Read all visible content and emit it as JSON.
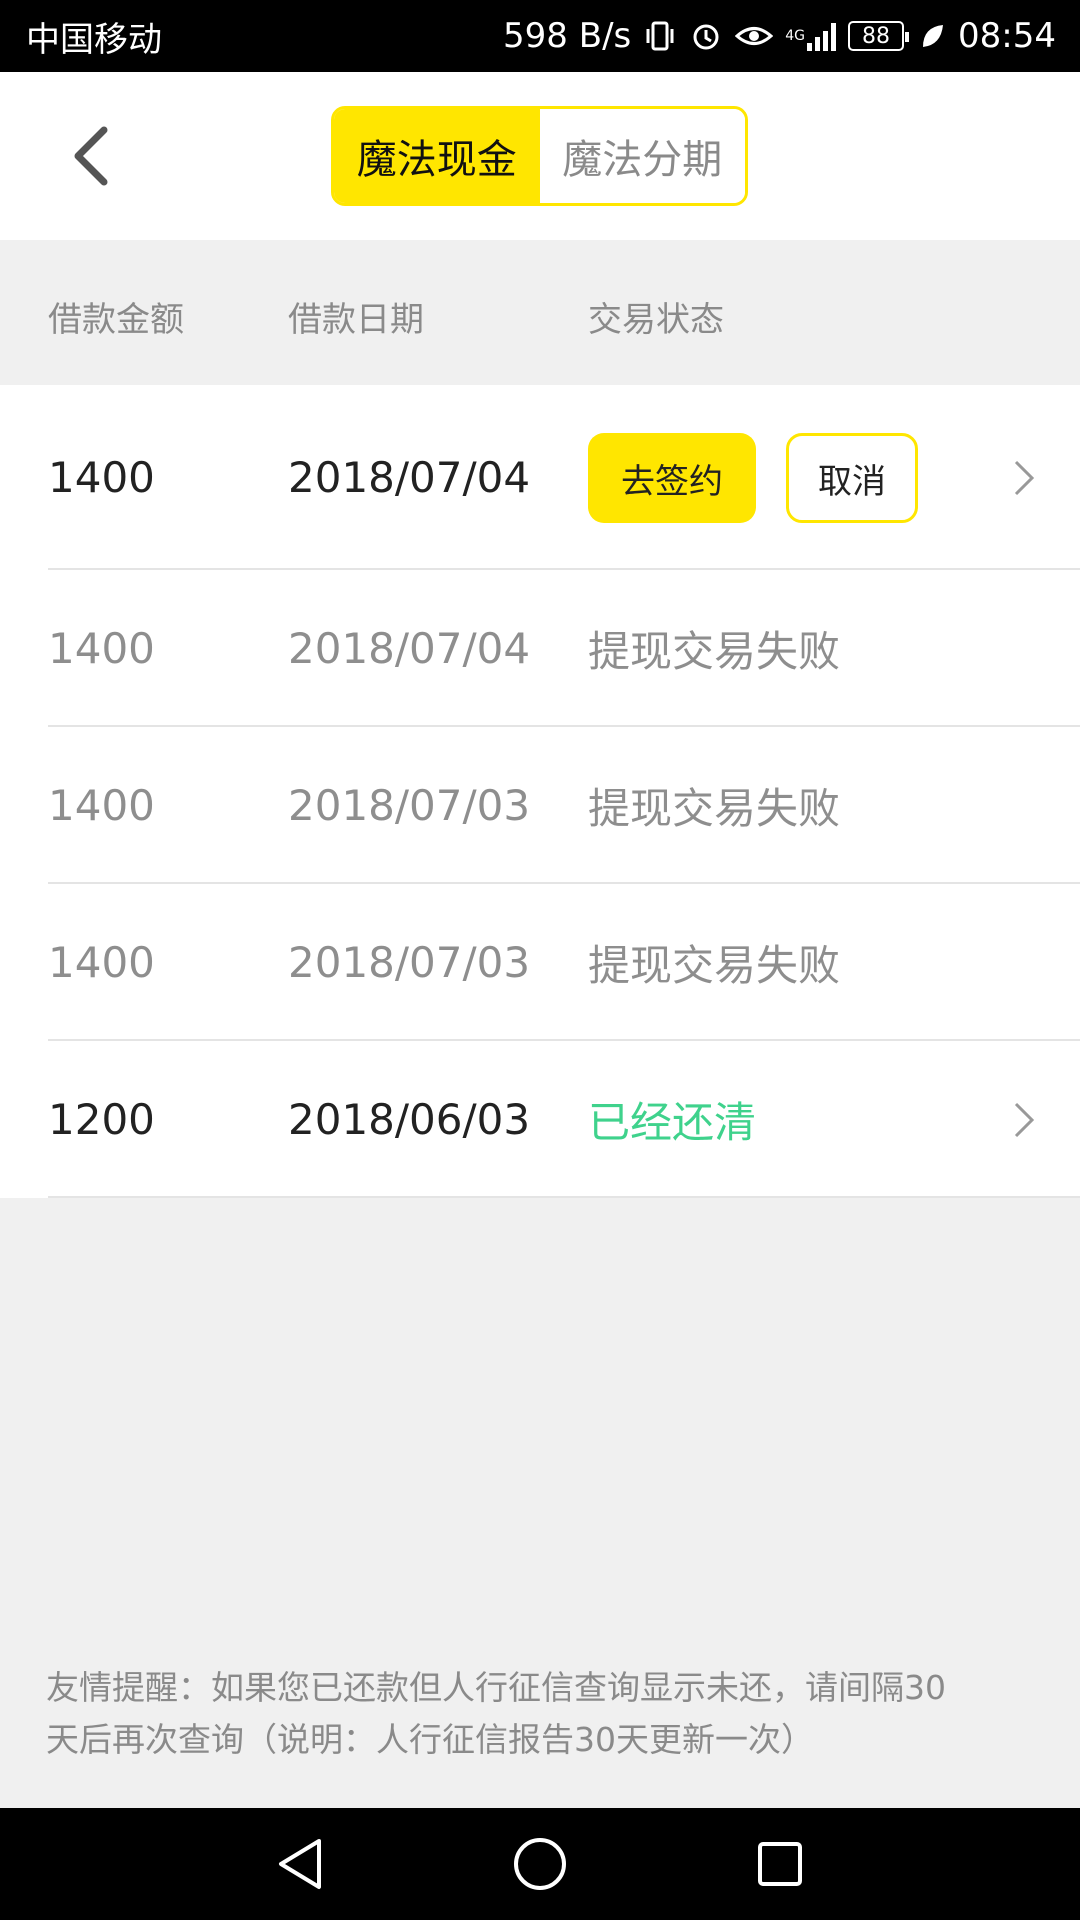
{
  "status_bar": {
    "carrier": "中国移动",
    "net_speed": "598 B/s",
    "network_type": "4G",
    "battery": "88",
    "time": "08:54",
    "icons": [
      "vibrate-icon",
      "alarm-icon",
      "eye-icon",
      "signal-icon",
      "battery-icon",
      "leaf-icon"
    ]
  },
  "header": {
    "tabs": [
      {
        "label": "魔法现金",
        "active": true
      },
      {
        "label": "魔法分期",
        "active": false
      }
    ],
    "accent_color": "#ffe600"
  },
  "table": {
    "columns": [
      "借款金额",
      "借款日期",
      "交易状态"
    ],
    "rows": [
      {
        "amount": "1400",
        "date": "2018/07/04",
        "status": "",
        "actions": {
          "sign": "去签约",
          "cancel": "取消"
        },
        "has_chevron": true
      },
      {
        "amount": "1400",
        "date": "2018/07/04",
        "status": "提现交易失败",
        "has_chevron": false
      },
      {
        "amount": "1400",
        "date": "2018/07/03",
        "status": "提现交易失败",
        "has_chevron": false
      },
      {
        "amount": "1400",
        "date": "2018/07/03",
        "status": "提现交易失败",
        "has_chevron": false
      },
      {
        "amount": "1200",
        "date": "2018/06/03",
        "status": "已经还清",
        "has_chevron": true
      }
    ],
    "status_colors": {
      "failed": "#8e8e8e",
      "paid": "#3fd28c"
    }
  },
  "tip": {
    "line1": "友情提醒：如果您已还款但人行征信查询显示未还，请间隔30",
    "line2": "天后再次查询（说明：人行征信报告30天更新一次）"
  },
  "nav": {
    "icons": [
      "back-triangle-icon",
      "home-circle-icon",
      "recents-square-icon"
    ]
  }
}
